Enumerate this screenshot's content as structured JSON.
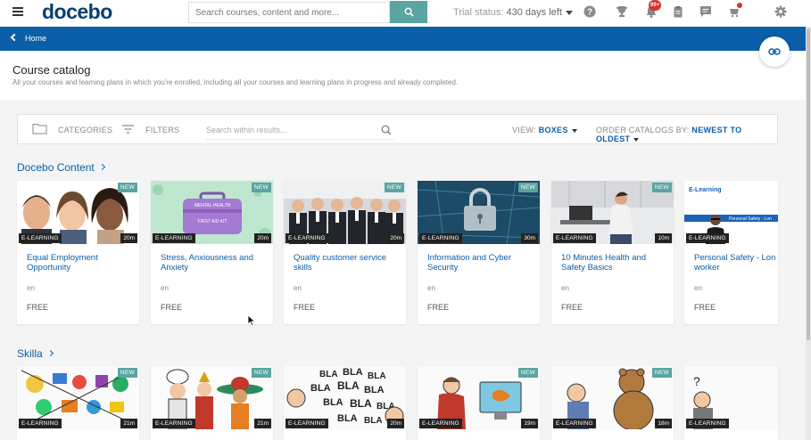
{
  "topbar": {
    "brand": "docebo",
    "search_placeholder": "Search courses, content and more...",
    "trial_label": "Trial status:",
    "trial_value": "430 days left",
    "notifications_badge": "99+"
  },
  "nav": {
    "home_label": "Home"
  },
  "header": {
    "title": "Course catalog",
    "subtitle": "All your courses and learning plans in which you're enrolled, including all your courses and learning plans in progress and already completed."
  },
  "filters": {
    "categories_label": "CATEGORIES",
    "filters_label": "FILTERS",
    "search_placeholder": "Search within results...",
    "view_label": "VIEW:",
    "view_value": "BOXES",
    "order_label": "ORDER CATALOGS BY:",
    "order_value": "NEWEST TO OLDEST"
  },
  "sections": [
    {
      "title": "Docebo Content",
      "cards": [
        {
          "title": "Equal Employment Opportunity",
          "lang": "en",
          "price": "FREE",
          "type": "E-LEARNING",
          "duration": "20m",
          "badge": "NEW"
        },
        {
          "title": "Stress, Anxiousness and Anxiety",
          "lang": "en",
          "price": "FREE",
          "type": "E-LEARNING",
          "duration": "20m",
          "badge": "NEW"
        },
        {
          "title": "Quality customer service skills",
          "lang": "en",
          "price": "FREE",
          "type": "E-LEARNING",
          "duration": "20m",
          "badge": "NEW"
        },
        {
          "title": "Information and Cyber Security",
          "lang": "en",
          "price": "FREE",
          "type": "E-LEARNING",
          "duration": "30m",
          "badge": "NEW"
        },
        {
          "title": "10 Minutes Health and Safety Basics",
          "lang": "en",
          "price": "FREE",
          "type": "E-LEARNING",
          "duration": "10m",
          "badge": "NEW"
        },
        {
          "title": "Personal Safety - Lon worker",
          "lang": "en",
          "price": "FREE",
          "type": "E-LEARNING",
          "duration": "",
          "badge": ""
        }
      ]
    },
    {
      "title": "Skilla",
      "cards": [
        {
          "type": "E-LEARNING",
          "duration": "21m",
          "badge": "NEW"
        },
        {
          "type": "E-LEARNING",
          "duration": "21m",
          "badge": "NEW"
        },
        {
          "type": "E-LEARNING",
          "duration": "20m",
          "badge": "NEW"
        },
        {
          "type": "E-LEARNING",
          "duration": "19m",
          "badge": "NEW"
        },
        {
          "type": "E-LEARNING",
          "duration": "18m",
          "badge": "NEW"
        },
        {
          "type": "E-LEARNING",
          "duration": "",
          "badge": ""
        }
      ]
    }
  ],
  "thumb_texts": {
    "kit_line1": "MENTAL HEALTH",
    "kit_line2": "FIRST AID KIT",
    "elearning_logo": "E-Learning",
    "banner": "Personal Safety : Lon",
    "bla": "BLA",
    "question_mark": "?"
  },
  "colors": {
    "brand_blue": "#0a5fa8",
    "accent_teal": "#5aa5a2",
    "badge_red": "#d8342a"
  }
}
